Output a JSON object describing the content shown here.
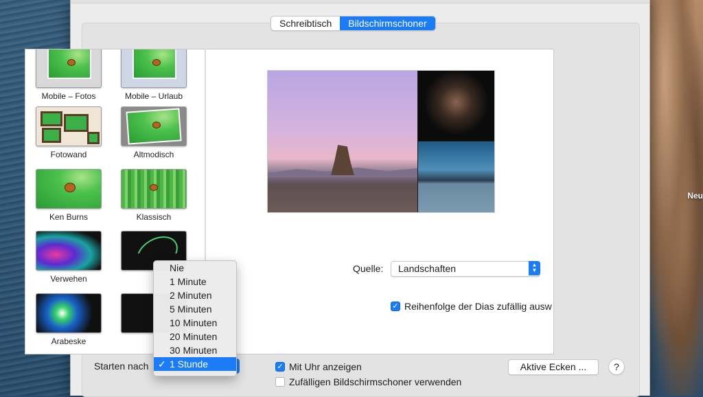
{
  "desktop": {
    "label": "Neu"
  },
  "tabs": [
    {
      "label": "Schreibtisch",
      "active": false
    },
    {
      "label": "Bildschirmschoner",
      "active": true
    }
  ],
  "screensavers": [
    {
      "label": "Mobile – Fotos"
    },
    {
      "label": "Mobile – Urlaub"
    },
    {
      "label": "Fotowand"
    },
    {
      "label": "Altmodisch"
    },
    {
      "label": "Ken Burns"
    },
    {
      "label": "Klassisch"
    },
    {
      "label": "Verwehen"
    },
    {
      "label": ""
    },
    {
      "label": "Arabeske"
    },
    {
      "label": ""
    }
  ],
  "source": {
    "label": "Quelle:",
    "value": "Landschaften"
  },
  "shuffle": {
    "label": "Reihenfolge der Dias zufällig ausw",
    "checked": true
  },
  "start": {
    "label": "Starten nach",
    "options": [
      "Nie",
      "1 Minute",
      "2 Minuten",
      "5 Minuten",
      "10 Minuten",
      "20 Minuten",
      "30 Minuten",
      "1 Stunde"
    ],
    "selected": "1 Stunde",
    "check_mark": "✓"
  },
  "show_clock": {
    "label": "Mit Uhr anzeigen",
    "checked": true
  },
  "random_saver": {
    "label": "Zufälligen Bildschirmschoner verwenden",
    "checked": false
  },
  "hot_corners_button": {
    "label": "Aktive Ecken ..."
  },
  "help_button": {
    "label": "?"
  },
  "colors": {
    "accent": "#1b7cf5"
  }
}
